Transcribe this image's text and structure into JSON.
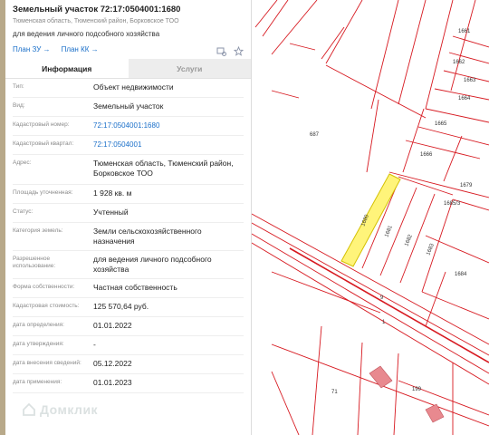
{
  "header": {
    "title": "Земельный участок 72:17:0504001:1680",
    "address_short": "Тюменская область, Тюменский район, Борковское ТОО",
    "purpose": "для ведения личного подсобного хозяйства",
    "plan_zu": "План ЗУ →",
    "plan_kk": "План КК →"
  },
  "tabs": {
    "info": "Информация",
    "services": "Услуги"
  },
  "rows": [
    {
      "label": "Тип:",
      "value": "Объект недвижимости"
    },
    {
      "label": "Вид:",
      "value": "Земельный участок"
    },
    {
      "label": "Кадастровый номер:",
      "value": "72:17:0504001:1680"
    },
    {
      "label": "Кадастровый квартал:",
      "value": "72:17:0504001"
    },
    {
      "label": "Адрес:",
      "value": "Тюменская область, Тюменский район, Борковское ТОО"
    },
    {
      "label": "Площадь уточненная:",
      "value": "1 928 кв. м"
    },
    {
      "label": "Статус:",
      "value": "Учтенный"
    },
    {
      "label": "Категория земель:",
      "value": "Земли сельскохозяйственного назначения"
    },
    {
      "label": "Разрешенное использование:",
      "value": "для ведения личного подсобного хозяйства"
    },
    {
      "label": "Форма собственности:",
      "value": "Частная собственность"
    },
    {
      "label": "Кадастровая стоимость:",
      "value": "125 570,64 руб."
    },
    {
      "label": "дата определения:",
      "value": "01.01.2022"
    },
    {
      "label": "дата утверждения:",
      "value": "-"
    },
    {
      "label": "дата внесения сведений:",
      "value": "05.12.2022"
    },
    {
      "label": "дата применения:",
      "value": "01.01.2023"
    }
  ],
  "watermark": "Домклик",
  "map": {
    "parcel_labels": {
      "p1661": "1661",
      "p1662": "1662",
      "p1663": "1663",
      "p1664": "1664",
      "p1665": "1665",
      "p1666": "1666",
      "p1679": "1679",
      "p1685_3": "1685/3",
      "p687": "687",
      "p1680": "1680",
      "p1681": "1681",
      "p1682": "1682",
      "p1683": "1683",
      "p1684": "1684",
      "p9": "9",
      "p1": "1",
      "p71": "71",
      "p199": "199"
    },
    "colors": {
      "line": "#d71920",
      "highlight_fill": "#fff47a",
      "highlight_stroke": "#d4c000",
      "building": "#e8898f"
    }
  }
}
